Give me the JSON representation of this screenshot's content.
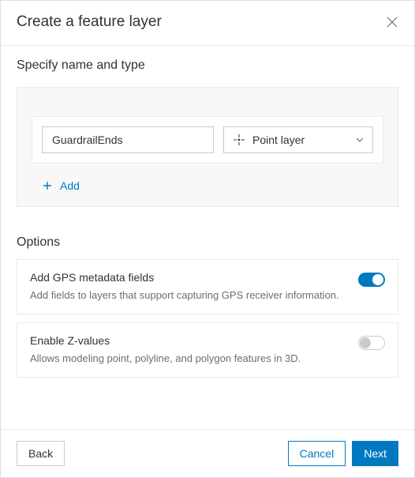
{
  "header": {
    "title": "Create a feature layer"
  },
  "specify": {
    "heading": "Specify name and type",
    "name_value": "GuardrailEnds",
    "type_label": "Point layer",
    "add_label": "Add"
  },
  "options": {
    "heading": "Options",
    "items": [
      {
        "title": "Add GPS metadata fields",
        "desc": "Add fields to layers that support capturing GPS receiver information.",
        "on": true
      },
      {
        "title": "Enable Z-values",
        "desc": "Allows modeling point, polyline, and polygon features in 3D.",
        "on": false
      }
    ]
  },
  "footer": {
    "back": "Back",
    "cancel": "Cancel",
    "next": "Next"
  }
}
